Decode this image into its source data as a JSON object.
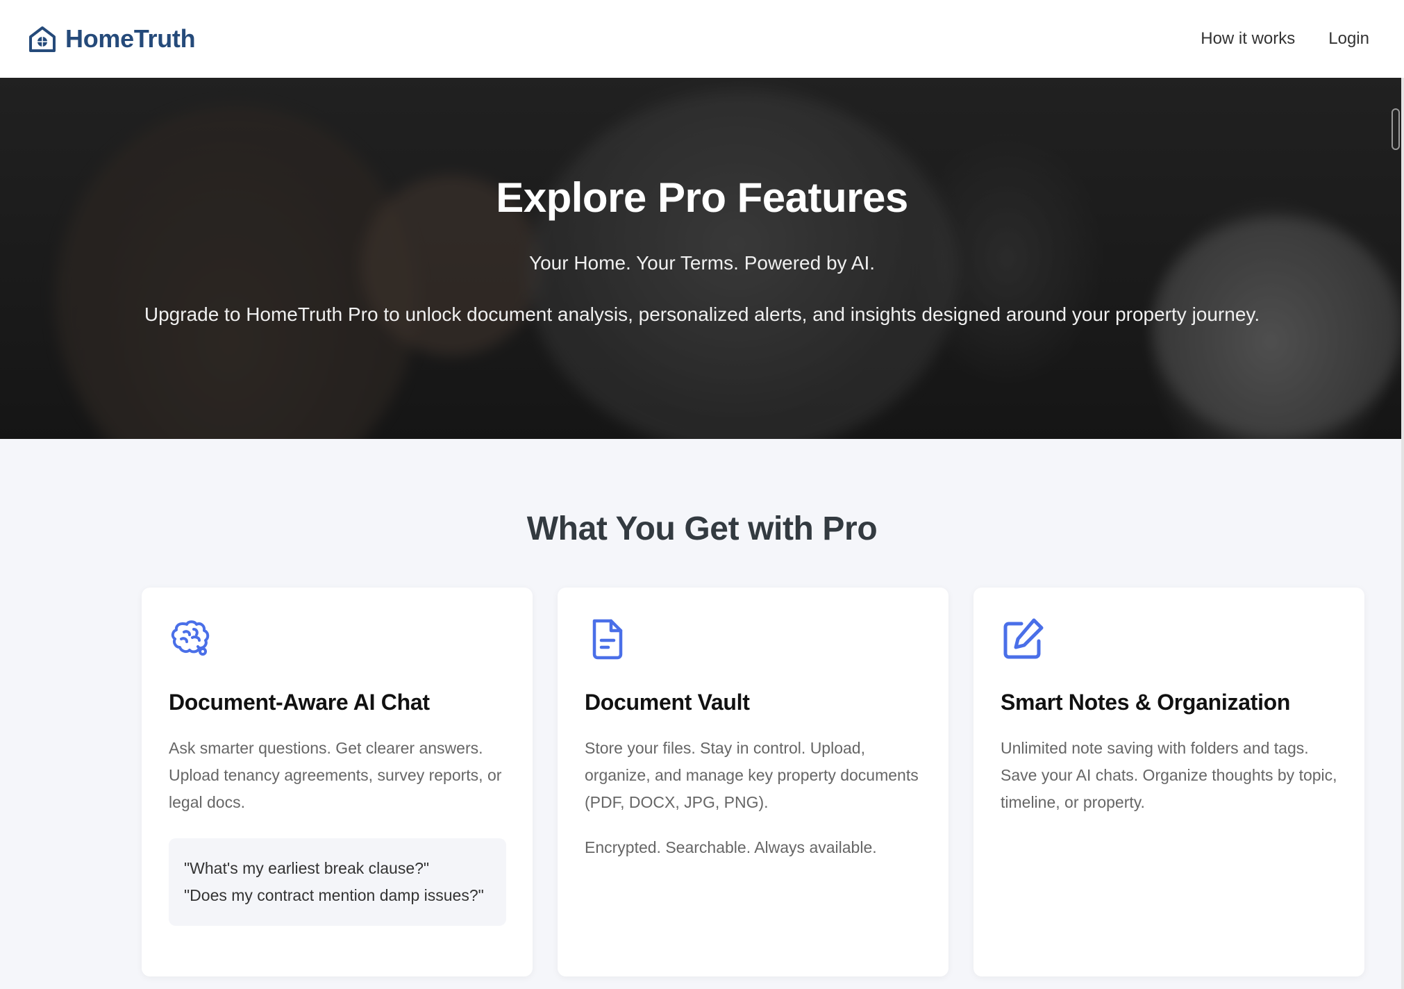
{
  "header": {
    "brand": "HomeTruth",
    "nav": [
      "How it works",
      "Login"
    ]
  },
  "hero": {
    "title": "Explore Pro Features",
    "subtitle": "Your Home. Your Terms. Powered by AI.",
    "description": "Upgrade to HomeTruth Pro to unlock document analysis, personalized alerts, and insights designed around your property journey."
  },
  "features": {
    "title": "What You Get with Pro",
    "cards": [
      {
        "icon": "brain-icon",
        "title": "Document-Aware AI Chat",
        "text": "Ask smarter questions. Get clearer answers. Upload tenancy agreements, survey reports, or legal docs.",
        "examples": [
          "\"What's my earliest break clause?\"",
          "\"Does my contract mention damp issues?\""
        ]
      },
      {
        "icon": "document-icon",
        "title": "Document Vault",
        "text": "Store your files. Stay in control. Upload, organize, and manage key property documents (PDF, DOCX, JPG, PNG).",
        "text2": "Encrypted. Searchable. Always available."
      },
      {
        "icon": "edit-icon",
        "title": "Smart Notes & Organization",
        "text": "Unlimited note saving with folders and tags. Save your AI chats. Organize thoughts by topic, timeline, or property."
      }
    ]
  },
  "colors": {
    "brand": "#254a7a",
    "accent_icon": "#4a6fe8",
    "section_bg": "#f5f6fa"
  }
}
